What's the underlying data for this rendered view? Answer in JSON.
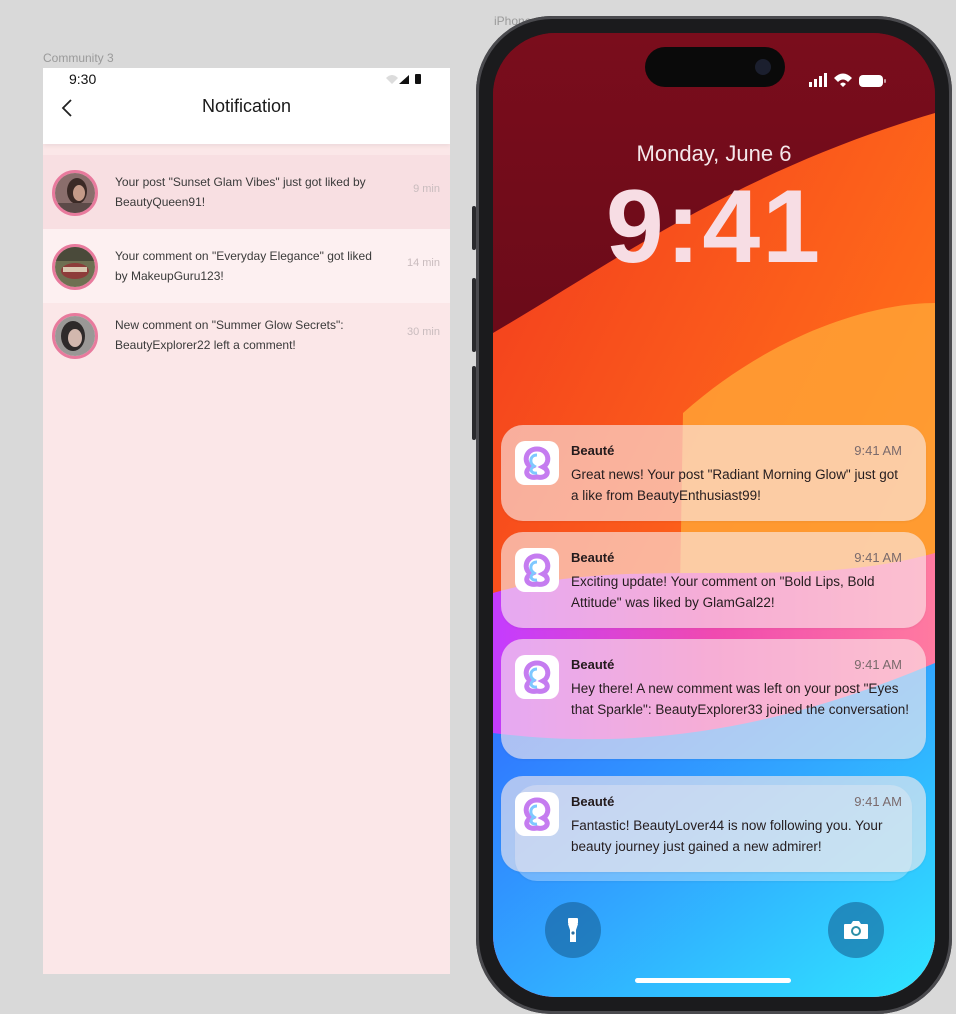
{
  "canvas": {
    "app_frame_label": "Community 3",
    "phone_frame_label": "iPhone"
  },
  "app": {
    "status_time": "9:30",
    "title": "Notification",
    "back_icon": "chevron-left-icon",
    "notifications": [
      {
        "text": "Your post \"Sunset Glam Vibes\" just got liked by BeautyQueen91!",
        "time": "9 min"
      },
      {
        "text": "Your comment on \"Everyday Elegance\" got liked by MakeupGuru123!",
        "time": "14 min"
      },
      {
        "text": "New comment on \"Summer Glow Secrets\": BeautyExplorer22 left a comment!",
        "time": "30 min"
      }
    ]
  },
  "phone": {
    "date": "Monday, June 6",
    "clock": "9:41",
    "notifications": [
      {
        "app": "Beauté",
        "time": "9:41 AM",
        "message": "Great news! Your post \"Radiant Morning Glow\" just got a like from BeautyEnthusiast99!"
      },
      {
        "app": "Beauté",
        "time": "9:41 AM",
        "message": "Exciting update! Your comment on \"Bold Lips, Bold Attitude\" was liked by GlamGal22!"
      },
      {
        "app": "Beauté",
        "time": "9:41 AM",
        "message": "Hey there! A new comment was left on your post \"Eyes that Sparkle\": BeautyExplorer33 joined the conversation!"
      },
      {
        "app": "Beauté",
        "time": "9:41 AM",
        "message": "Fantastic! BeautyLover44 is now following you. Your beauty journey just gained a new admirer!"
      }
    ],
    "flashlight_icon": "flashlight-icon",
    "camera_icon": "camera-icon"
  },
  "colors": {
    "app_background": "#fbe7e8",
    "avatar_ring": "#e87a9d",
    "phone_frame": "#1b1b1d"
  }
}
